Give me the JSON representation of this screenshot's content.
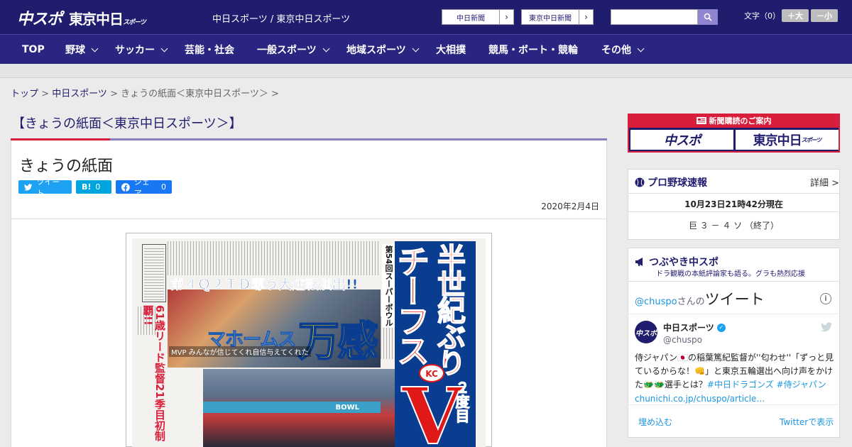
{
  "header": {
    "logo_chuspo": "中スポ",
    "logo_tokyo": "東京中日",
    "logo_tokyo_small": "スポーツ",
    "site_title": "中日スポーツ / 東京中日スポーツ",
    "ext_links": [
      "中日新聞",
      "東京中日新聞"
    ],
    "search_placeholder": "",
    "font_size_label": "文字（0）",
    "font_plus": "＋大",
    "font_minus": "－小"
  },
  "nav": [
    {
      "label": "TOP",
      "has_menu": false
    },
    {
      "label": "野球",
      "has_menu": true
    },
    {
      "label": "サッカー",
      "has_menu": true
    },
    {
      "label": "芸能・社会",
      "has_menu": false
    },
    {
      "label": "一般スポーツ",
      "has_menu": true
    },
    {
      "label": "地域スポーツ",
      "has_menu": true
    },
    {
      "label": "大相撲",
      "has_menu": false
    },
    {
      "label": "競馬・ボート・競輪",
      "has_menu": false
    },
    {
      "label": "その他",
      "has_menu": true
    }
  ],
  "breadcrumb": {
    "top": "トップ",
    "sep1": " > ",
    "section": "中日スポーツ",
    "sep2": " > ",
    "current": "きょうの紙面＜東京中日スポーツ＞ >"
  },
  "main": {
    "heading": "【きょうの紙面＜東京中日スポーツ＞】",
    "title": "きょうの紙面",
    "share": {
      "tweet": "ツイート",
      "hatena_label": "B!",
      "hatena_count": "0",
      "facebook_label": "シェア",
      "facebook_count": "0"
    },
    "date": "2020年2月4日"
  },
  "newspaper": {
    "headline_blue": "第４Ｑ２ＴＤ奪う大逆転演出!!",
    "chiefs": "チーフス",
    "hanseiki": "半世紀ぶり",
    "second_time": "２度目",
    "big_v": "V",
    "superbowl": "第54回スーパーボウル",
    "left_text": "61歳リード監督21季目初制覇!!",
    "mahomes": "マホームス",
    "mankan": "万感",
    "mvp": "MVP みんなが信じてくれ自信与えてくれた"
  },
  "sidebar": {
    "promo_head": "新聞購読のご案内",
    "promo_chuspo": "中スポ",
    "promo_tokyo": "東京中日",
    "promo_tokyo_small": "スポーツ",
    "baseball_title": "プロ野球速報",
    "baseball_detail": "詳細 >",
    "baseball_time": "10月23日21時42分現在",
    "baseball_score": "巨 ３ － ４ ソ （終了）",
    "tweets_title": "つぶやき中スポ",
    "tweets_sub": "ドラ観戦の本紙評論家も語る。グラも熱烈応援",
    "tw_header_user": "@chuspo",
    "tw_header_san": "さんの",
    "tw_header_big": "ツイート",
    "tw_name": "中日スポーツ",
    "tw_handle": "@chuspo",
    "tw_text_1": "侍ジャパン🇯🇵の稲葉篤紀監督が''匂わせ''「ずっと見ているからな！👊」と東京五輪選出へ向け声をかけた🐲🐲選手とは？",
    "tw_text_link": "#中日ドラゴンズ #侍ジャパン chunichi.co.jp/chuspo/article…",
    "tw_embed": "埋め込む",
    "tw_view": "Twitterで表示"
  },
  "colors": {
    "brand_navy": "#201c6e",
    "nav_bg": "#2a2580",
    "accent_red": "#d81e3a",
    "twitter_blue": "#1b95e0"
  }
}
